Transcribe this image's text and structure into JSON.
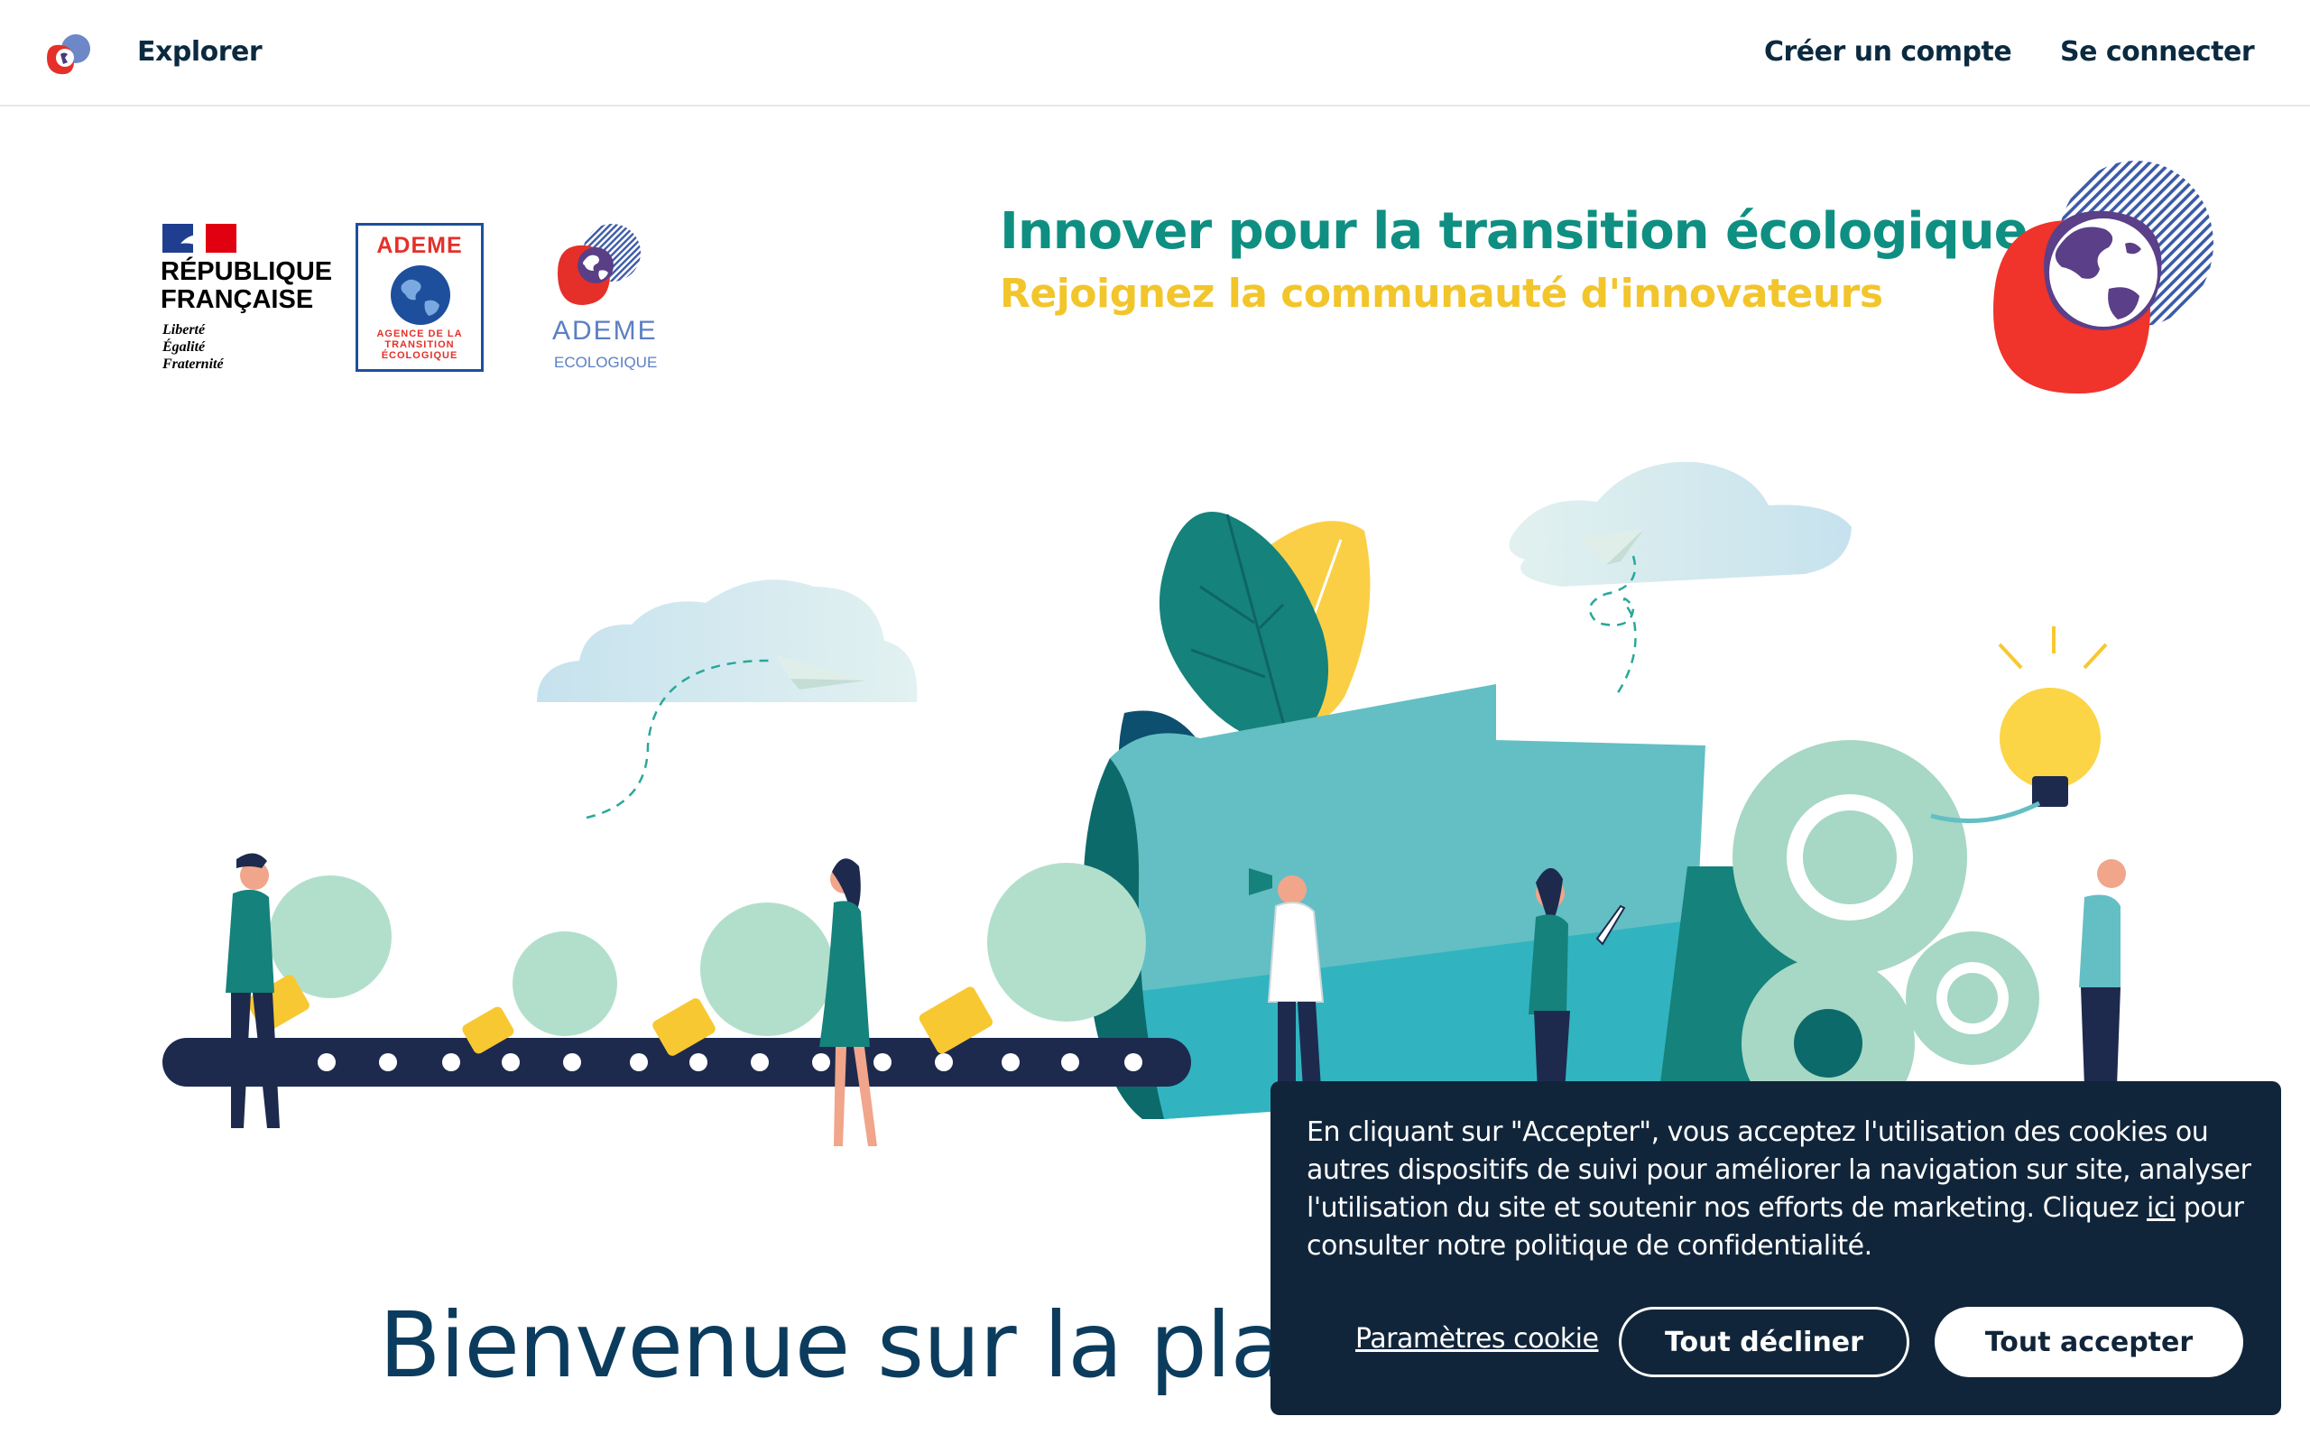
{
  "nav": {
    "explore_label": "Explorer",
    "create_account_label": "Créer un compte",
    "login_label": "Se connecter"
  },
  "partners": {
    "rf": {
      "title_line1": "RÉPUBLIQUE",
      "title_line2": "FRANÇAISE",
      "motto_line1": "Liberté",
      "motto_line2": "Égalité",
      "motto_line3": "Fraternité"
    },
    "ademe_box": {
      "title": "ADEME",
      "subtitle": "AGENCE DE LA\nTRANSITION\nÉCOLOGIQUE"
    },
    "ademe_eco": {
      "name": "ADEME",
      "subtitle": "ECOLOGIQUE"
    }
  },
  "hero": {
    "headline": "Innover pour la transition écologique",
    "subheadline": "Rejoignez la communauté d'innovateurs"
  },
  "welcome": {
    "title": "Bienvenue sur la plat"
  },
  "cookie_banner": {
    "text_before_link": "En cliquant sur \"Accepter\", vous acceptez l'utilisation des cookies ou autres dispositifs de suivi pour améliorer la navigation sur site, analyser l'utilisation du site et soutenir nos efforts de marketing. Cliquez ",
    "link_label": "ici",
    "text_after_link": " pour consulter notre politique de confidentialité.",
    "settings_label": "Paramètres cookie",
    "decline_label": "Tout décliner",
    "accept_label": "Tout accepter"
  },
  "colors": {
    "brand_teal": "#0e8f82",
    "brand_yellow": "#f2c52b",
    "brand_red": "#e5302a",
    "brand_navy": "#11253a",
    "nav_text": "#0b2a40"
  }
}
